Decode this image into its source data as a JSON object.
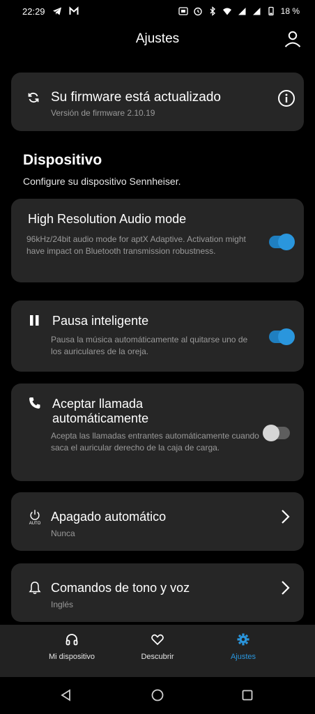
{
  "status": {
    "time": "22:29",
    "battery": "18 %"
  },
  "header": {
    "title": "Ajustes"
  },
  "firmware": {
    "title": "Su firmware está actualizado",
    "version": "Versión de firmware 2.10.19"
  },
  "section": {
    "title": "Dispositivo",
    "subtitle": "Configure su dispositivo Sennheiser."
  },
  "settings": {
    "hires": {
      "title": "High Resolution Audio mode",
      "desc": "96kHz/24bit audio mode for aptX Adaptive. Activation might have impact on Bluetooth transmission robustness.",
      "enabled": true
    },
    "pause": {
      "title": "Pausa inteligente",
      "desc": "Pausa la música automáticamente al quitarse uno de los auriculares de la oreja.",
      "enabled": true
    },
    "call": {
      "title_line1": "Aceptar llamada",
      "title_line2": "automáticamente",
      "desc": "Acepta las llamadas entrantes automáticamente cuando saca el auricular derecho de la caja de carga.",
      "enabled": false
    },
    "autooff": {
      "title": "Apagado automático",
      "value": "Nunca",
      "icon_label": "AUTO"
    },
    "prompts": {
      "title": "Comandos de tono y voz",
      "value": "Inglés"
    }
  },
  "nav": {
    "items": [
      {
        "label": "Mi dispositivo",
        "icon": "headphones-icon"
      },
      {
        "label": "Descubrir",
        "icon": "heart-icon"
      },
      {
        "label": "Ajustes",
        "icon": "gear-icon",
        "active": true
      }
    ]
  },
  "colors": {
    "accent": "#2a96dd",
    "card": "#262626",
    "background": "#000000"
  }
}
